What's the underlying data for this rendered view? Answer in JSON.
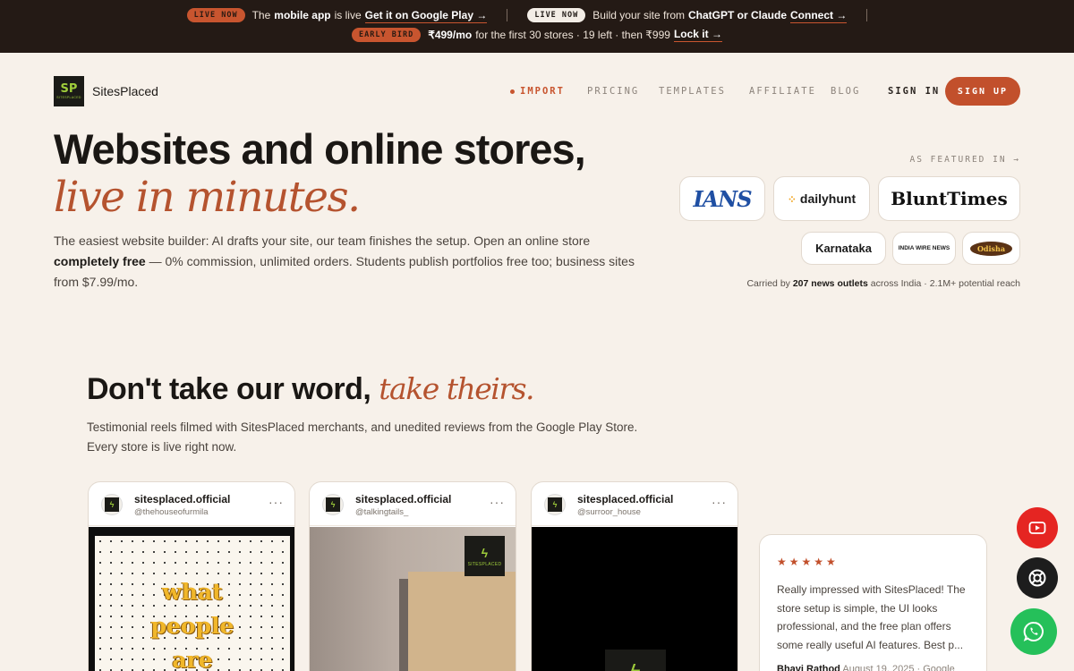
{
  "announcement": {
    "live_pill": "LIVE NOW",
    "app_prefix": "The",
    "app_bold": "mobile app",
    "app_suffix": "is live",
    "app_link": "Get it on Google Play →",
    "live_pill_2": "LIVE NOW",
    "build_prefix": "Build your site from",
    "build_bold": "ChatGPT or Claude",
    "build_link": "Connect →",
    "early_pill": "EARLY BIRD",
    "early_price": "₹499/mo",
    "early_text": "for the first 30 stores · 19 left · then ₹999",
    "early_link": "Lock it →"
  },
  "header": {
    "brand": "SitesPlaced",
    "logo_mark": "SP",
    "logo_text": "SITESPLACED",
    "nav": [
      "IMPORT",
      "PRICING",
      "TEMPLATES",
      "AFFILIATE",
      "BLOG"
    ],
    "signin": "SIGN IN",
    "signup": "SIGN UP"
  },
  "hero": {
    "title_plain": "Websites and online stores, ",
    "title_accent": "live in minutes.",
    "sub_1": "The easiest website builder: AI drafts your site, our team finishes the setup. Open an online store ",
    "sub_bold": "completely free",
    "sub_2": " — 0% commission, unlimited orders. Students publish portfolios free too; business sites from $7.99/mo."
  },
  "featured": {
    "label": "AS FEATURED IN →",
    "outlets": [
      "IANS",
      "dailyhunt",
      "BluntTimes",
      "Karnataka",
      "INDIA WIRE NEWS",
      "Odisha"
    ],
    "carried_prefix": "Carried by",
    "carried_bold": "207 news outlets",
    "carried_suffix": "across India · 2.1M+ potential reach"
  },
  "testimonials": {
    "title_plain": "Don't take our word, ",
    "title_accent": "take theirs.",
    "subtitle": "Testimonial reels filmed with SitesPlaced merchants, and unedited reviews from the Google Play Store. Every store is live right now.",
    "reels": [
      {
        "account": "sitesplaced.official",
        "handle": "@thehouseofurmila",
        "words": [
          "what",
          "people",
          "are"
        ]
      },
      {
        "account": "sitesplaced.official",
        "handle": "@talkingtails_",
        "watermark": "SITESPLACED"
      },
      {
        "account": "sitesplaced.official",
        "handle": "@surroor_house"
      }
    ],
    "review": {
      "stars": "★★★★★",
      "rating": 5,
      "text": "Really impressed with SitesPlaced! The store setup is simple, the UI looks professional, and the free plan offers some really useful AI features. Best p...",
      "author": "Bhavi Rathod",
      "meta": "August 19, 2025 · Google"
    }
  },
  "floating": [
    "youtube-icon",
    "help-lifebuoy-icon",
    "whatsapp-icon"
  ],
  "colors": {
    "accent": "#c2502c",
    "announcement_bg": "#241a15",
    "page_bg": "#f7f1ea",
    "logo_green": "#9fcd3b"
  }
}
